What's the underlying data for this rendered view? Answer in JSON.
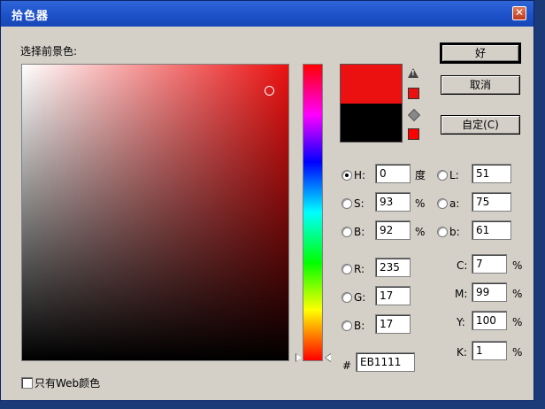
{
  "window": {
    "title": "拾色器"
  },
  "picker": {
    "label": "选择前景色:"
  },
  "buttons": {
    "ok": "好",
    "cancel": "取消",
    "custom": "自定(C)"
  },
  "colors": {
    "current": "#ec1111",
    "previous": "#000000",
    "warning_swatch": "#ec1111",
    "web_safe_swatch": "#ff0000"
  },
  "hsb": [
    {
      "label": "H:",
      "value": "0",
      "unit": "度",
      "checked": true
    },
    {
      "label": "S:",
      "value": "93",
      "unit": "%",
      "checked": false
    },
    {
      "label": "B:",
      "value": "92",
      "unit": "%",
      "checked": false
    }
  ],
  "lab": [
    {
      "label": "L:",
      "value": "51"
    },
    {
      "label": "a:",
      "value": "75"
    },
    {
      "label": "b:",
      "value": "61"
    }
  ],
  "rgb": [
    {
      "label": "R:",
      "value": "235"
    },
    {
      "label": "G:",
      "value": "17"
    },
    {
      "label": "B:",
      "value": "17"
    }
  ],
  "cmyk": [
    {
      "label": "C:",
      "value": "7",
      "unit": "%"
    },
    {
      "label": "M:",
      "value": "99",
      "unit": "%"
    },
    {
      "label": "Y:",
      "value": "100",
      "unit": "%"
    },
    {
      "label": "K:",
      "value": "1",
      "unit": "%"
    }
  ],
  "hex": {
    "label": "#",
    "value": "EB1111"
  },
  "web_only": {
    "label": "只有Web颜色",
    "checked": false
  }
}
